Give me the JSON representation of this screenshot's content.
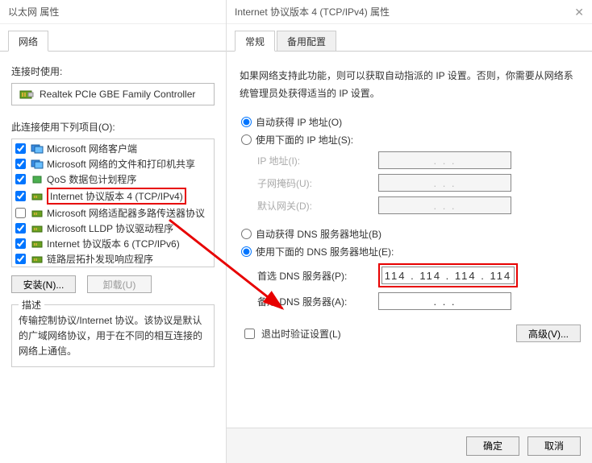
{
  "ethernet": {
    "title": "以太网 属性",
    "tab_network": "网络",
    "connect_using_label": "连接时使用:",
    "adapter_name": "Realtek PCIe GBE Family Controller",
    "items_label": "此连接使用下列项目(O):",
    "items": [
      {
        "label": "Microsoft 网络客户端",
        "checked": true,
        "icon": "client"
      },
      {
        "label": "Microsoft 网络的文件和打印机共享",
        "checked": true,
        "icon": "share"
      },
      {
        "label": "QoS 数据包计划程序",
        "checked": true,
        "icon": "qos"
      },
      {
        "label": "Internet 协议版本 4 (TCP/IPv4)",
        "checked": true,
        "icon": "proto",
        "highlight": true
      },
      {
        "label": "Microsoft 网络适配器多路传送器协议",
        "checked": false,
        "icon": "proto"
      },
      {
        "label": "Microsoft LLDP 协议驱动程序",
        "checked": true,
        "icon": "proto"
      },
      {
        "label": "Internet 协议版本 6 (TCP/IPv6)",
        "checked": true,
        "icon": "proto"
      },
      {
        "label": "链路层拓扑发现响应程序",
        "checked": true,
        "icon": "proto"
      }
    ],
    "btn_install": "安装(N)...",
    "btn_uninstall": "卸载(U)",
    "desc_legend": "描述",
    "desc_text": "传输控制协议/Internet 协议。该协议是默认的广域网络协议，用于在不同的相互连接的网络上通信。"
  },
  "tcpip": {
    "title": "Internet 协议版本 4 (TCP/IPv4) 属性",
    "tab_general": "常规",
    "tab_alt": "备用配置",
    "info": "如果网络支持此功能，则可以获取自动指派的 IP 设置。否则，你需要从网络系统管理员处获得适当的 IP 设置。",
    "radio_auto_ip": "自动获得 IP 地址(O)",
    "radio_manual_ip": "使用下面的 IP 地址(S):",
    "ip_label": "IP 地址(I):",
    "mask_label": "子网掩码(U):",
    "gw_label": "默认网关(D):",
    "ip_dots": ".       .       .",
    "radio_auto_dns": "自动获得 DNS 服务器地址(B)",
    "radio_manual_dns": "使用下面的 DNS 服务器地址(E):",
    "dns1_label": "首选 DNS 服务器(P):",
    "dns1_value": "114 . 114 . 114 . 114",
    "dns2_label": "备用 DNS 服务器(A):",
    "chk_validate": "退出时验证设置(L)",
    "btn_advanced": "高级(V)...",
    "btn_ok": "确定",
    "btn_cancel": "取消"
  }
}
